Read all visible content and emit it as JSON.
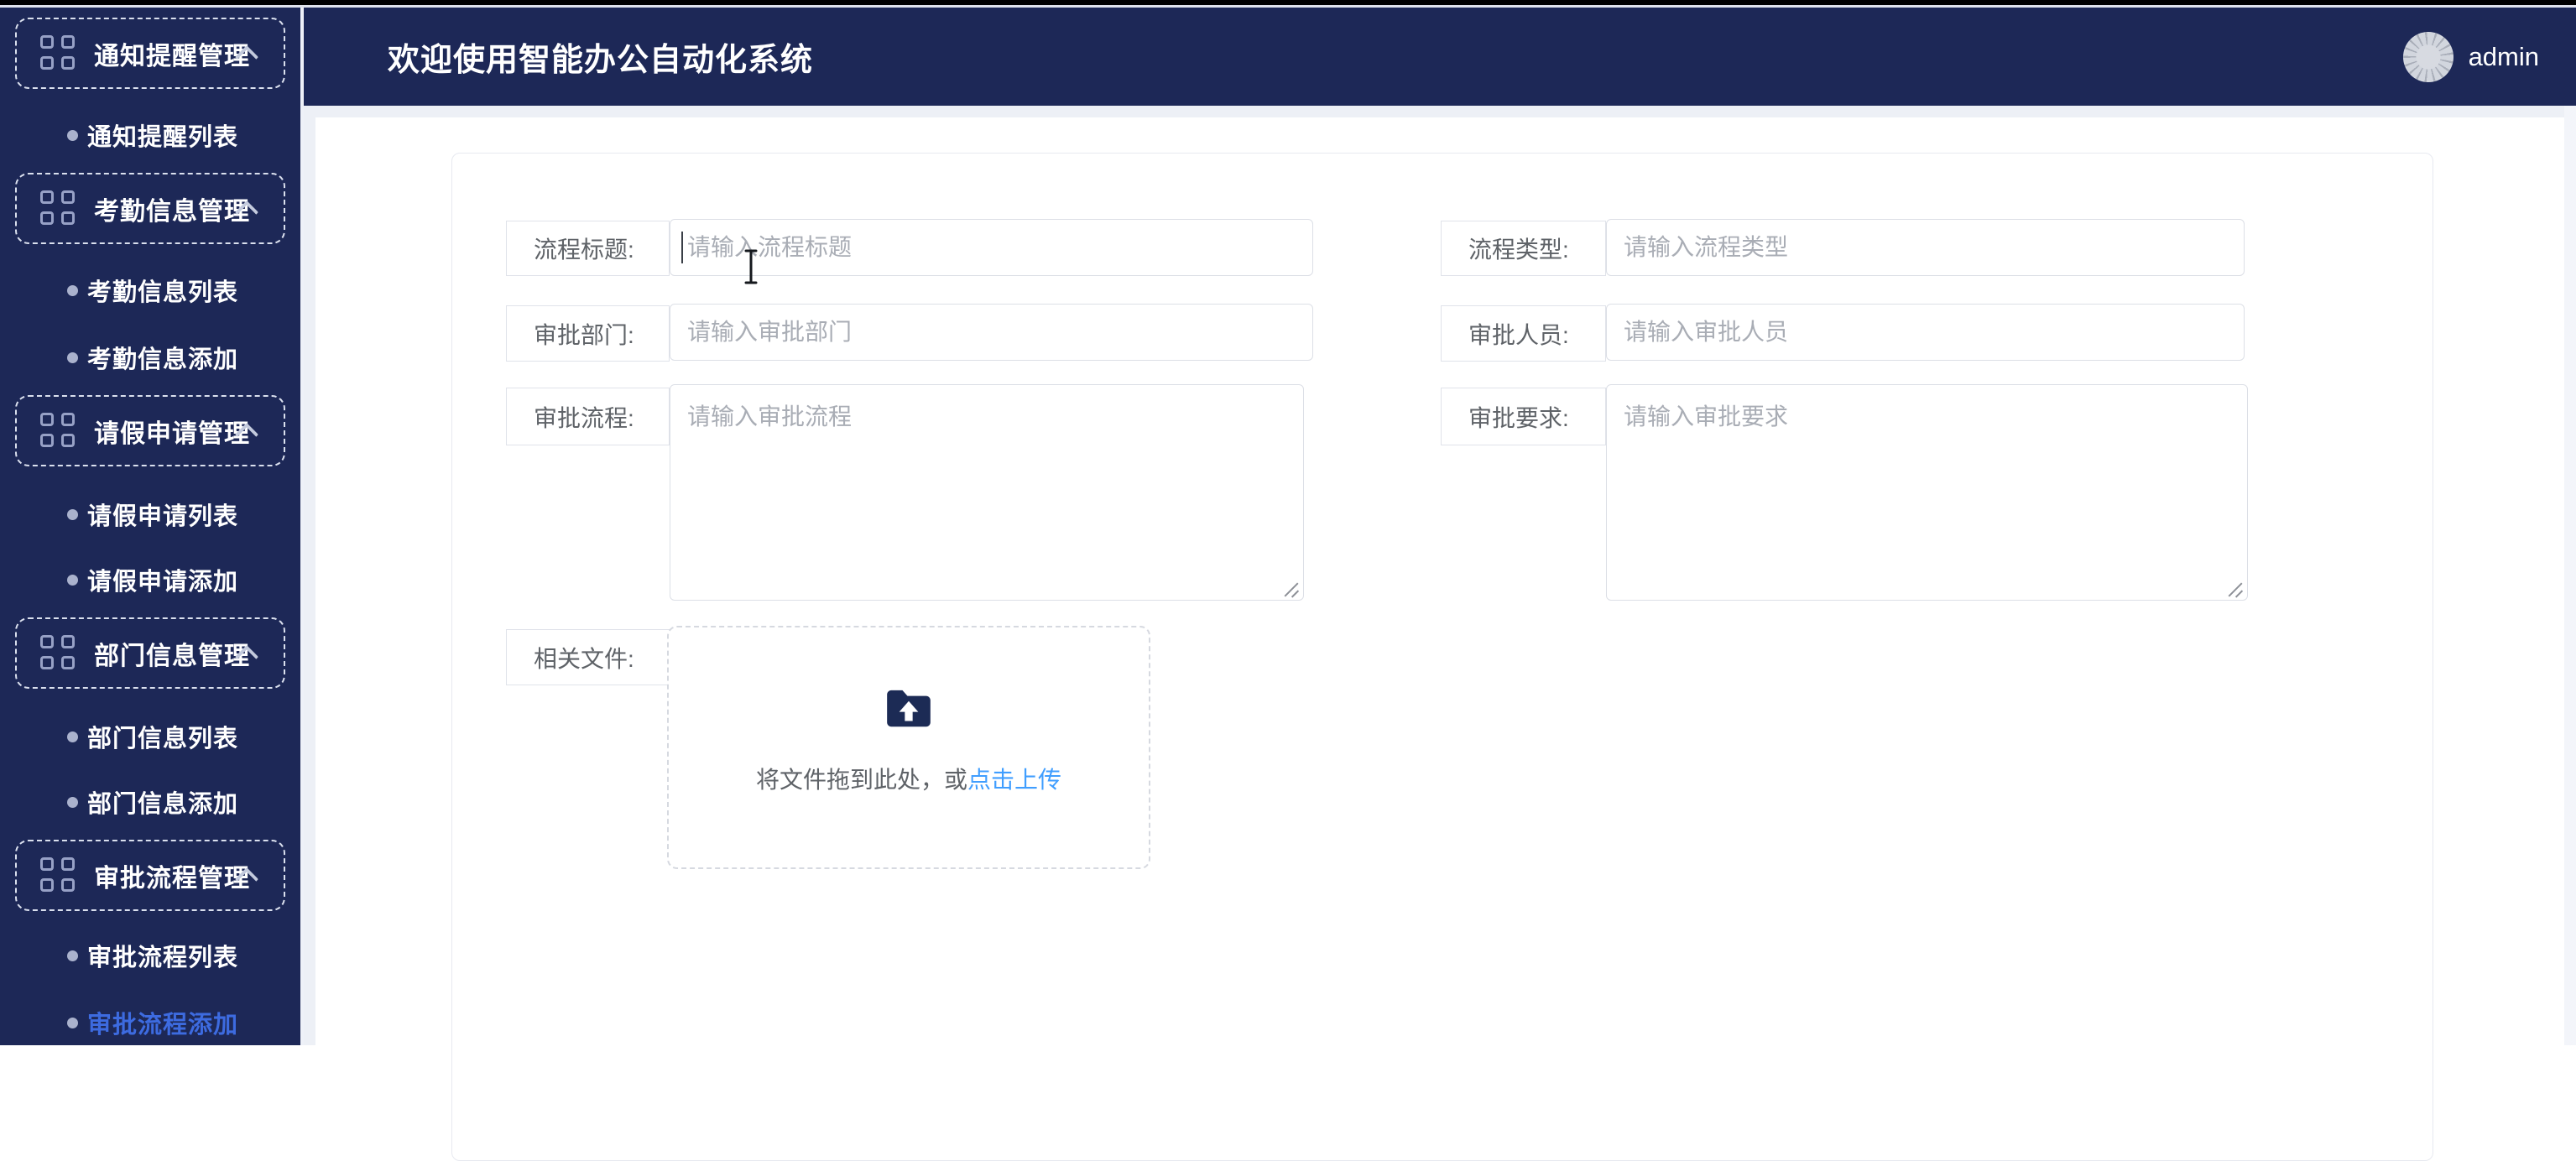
{
  "header": {
    "title": "欢迎使用智能办公自动化系统",
    "user": "admin"
  },
  "sidebar": {
    "groups": [
      {
        "label": "通知提醒管理",
        "items": [
          {
            "label": "通知提醒列表"
          }
        ]
      },
      {
        "label": "考勤信息管理",
        "items": [
          {
            "label": "考勤信息列表"
          },
          {
            "label": "考勤信息添加"
          }
        ]
      },
      {
        "label": "请假申请管理",
        "items": [
          {
            "label": "请假申请列表"
          },
          {
            "label": "请假申请添加"
          }
        ]
      },
      {
        "label": "部门信息管理",
        "items": [
          {
            "label": "部门信息列表"
          },
          {
            "label": "部门信息添加"
          }
        ]
      },
      {
        "label": "审批流程管理",
        "items": [
          {
            "label": "审批流程列表"
          },
          {
            "label": "审批流程添加",
            "active": true
          }
        ]
      }
    ]
  },
  "form": {
    "fields": {
      "title": {
        "label": "流程标题:",
        "placeholder": "请输入流程标题",
        "value": ""
      },
      "type": {
        "label": "流程类型:",
        "placeholder": "请输入流程类型",
        "value": ""
      },
      "department": {
        "label": "审批部门:",
        "placeholder": "请输入审批部门",
        "value": ""
      },
      "personnel": {
        "label": "审批人员:",
        "placeholder": "请输入审批人员",
        "value": ""
      },
      "process": {
        "label": "审批流程:",
        "placeholder": "请输入审批流程",
        "value": ""
      },
      "require": {
        "label": "审批要求:",
        "placeholder": "请输入审批要求",
        "value": ""
      },
      "files": {
        "label": "相关文件:"
      }
    },
    "upload": {
      "drag_text": "将文件拖到此处，或",
      "link_text": "点击上传"
    }
  },
  "colors": {
    "navy": "#1d2857",
    "active_link": "#3d6be0",
    "upload_link": "#409eff",
    "label_text": "#5f6368",
    "placeholder": "#a9adb5",
    "input_border": "#dcdfe6"
  }
}
